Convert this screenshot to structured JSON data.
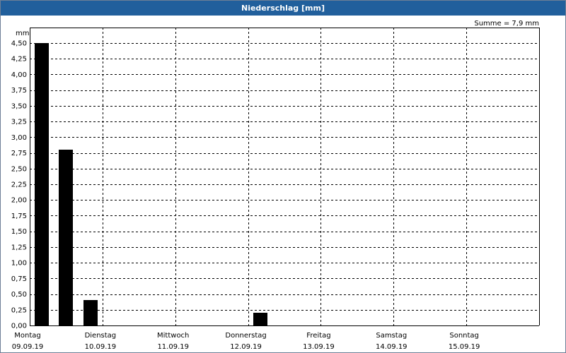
{
  "title": "Niederschlag [mm]",
  "summary": "Summe = 7,9 mm",
  "colors": {
    "title_bar": "#215f9c",
    "title_text": "#ffffff",
    "bars": "#000000",
    "grid": "#000000"
  },
  "chart_data": {
    "type": "bar",
    "title": "Niederschlag [mm]",
    "ylabel": "mm",
    "ylim": [
      0,
      4.5
    ],
    "yticks": [
      "0,00",
      "0,25",
      "0,50",
      "0,75",
      "1,00",
      "1,25",
      "1,50",
      "1,75",
      "2,00",
      "2,25",
      "2,50",
      "2,75",
      "3,00",
      "3,25",
      "3,50",
      "3,75",
      "4,00",
      "4,25",
      "4,50"
    ],
    "grid": "dashed",
    "days": [
      {
        "label": "Montag",
        "date": "09.09.19"
      },
      {
        "label": "Dienstag",
        "date": "10.09.19"
      },
      {
        "label": "Mittwoch",
        "date": "11.09.19"
      },
      {
        "label": "Donnerstag",
        "date": "12.09.19"
      },
      {
        "label": "Freitag",
        "date": "13.09.19"
      },
      {
        "label": "Samstag",
        "date": "14.09.19"
      },
      {
        "label": "Sonntag",
        "date": "15.09.19"
      }
    ],
    "bars": [
      {
        "day": "09.09.19",
        "period": 1,
        "value": 4.5
      },
      {
        "day": "09.09.19",
        "period": 2,
        "value": 2.8
      },
      {
        "day": "09.09.19",
        "period": 3,
        "value": 0.4
      },
      {
        "day": "12.09.19",
        "period": 1,
        "value": 0.2
      }
    ],
    "summary": "Summe = 7,9 mm"
  }
}
